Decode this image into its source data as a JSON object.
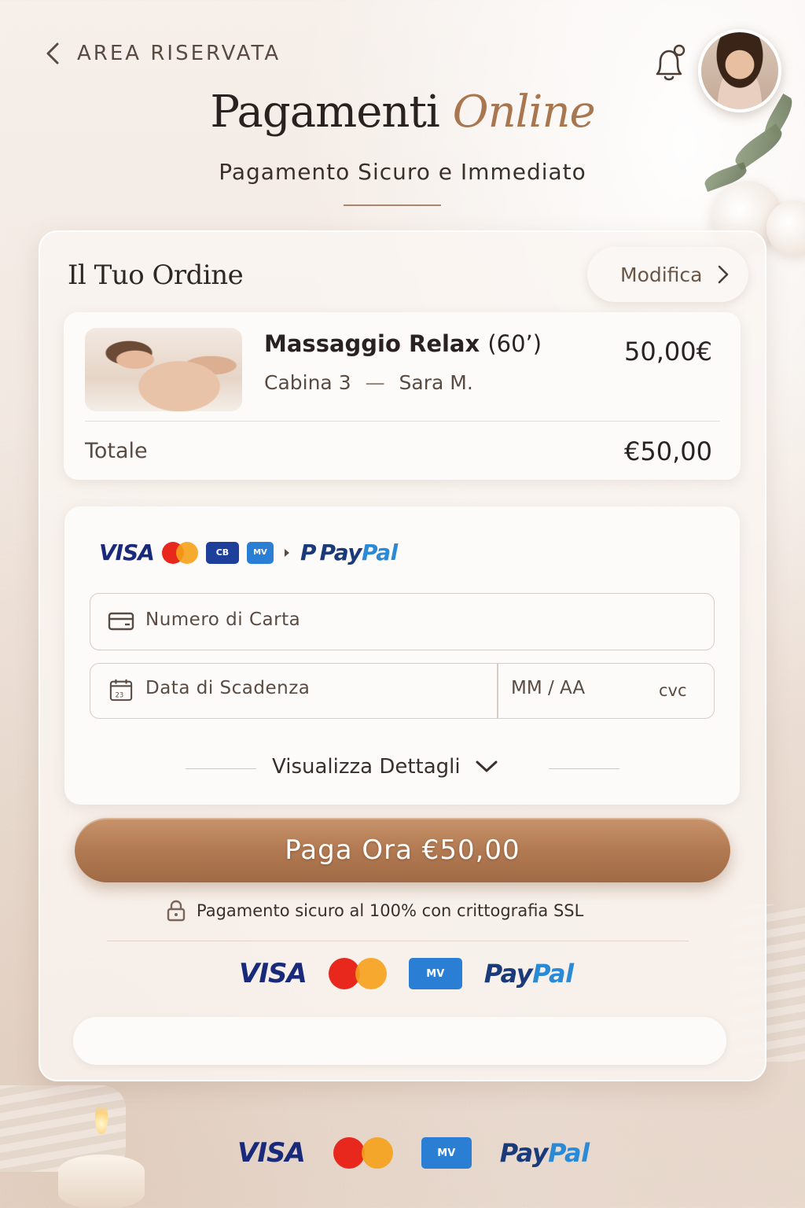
{
  "header": {
    "back_label": "AREA RISERVATA",
    "title_main": "Pagamenti",
    "title_accent": "Online",
    "subtitle": "Pagamento Sicuro e Immediato"
  },
  "order": {
    "title": "Il Tuo Ordine",
    "modify_label": "Modifica",
    "item": {
      "name": "Massaggio Relax",
      "duration": "(60’)",
      "cabin": "Cabina 3",
      "separator": "—",
      "therapist": "Sara M.",
      "price": "50,00€"
    },
    "total_label": "Totale",
    "total_value": "€50,00"
  },
  "payment": {
    "methods": {
      "visa": "VISA",
      "paypal_pay": "Pay",
      "paypal_pal": "Pal",
      "paypal_p": "P",
      "badge_1": "CB",
      "badge_2": "MV"
    },
    "card_number_placeholder": "Numero di Carta",
    "expiry_placeholder": "Data di Scadenza",
    "calendar_day": "23",
    "mm_aa_placeholder": "MM / AA",
    "cvc_placeholder": "cvc",
    "details_label": "Visualizza Dettagli"
  },
  "pay_button_label": "Paga Ora €50,00",
  "secure_note": "Pagamento sicuro al 100% con crittografia SSL",
  "icons": [
    "chevron-left-icon",
    "bell-icon",
    "chevron-right-icon",
    "credit-card-icon",
    "calendar-icon",
    "chevron-down-icon",
    "lock-icon"
  ],
  "colors": {
    "accent": "#a8764f",
    "button": "#b27a52",
    "visa": "#1a2a7a",
    "paypal_dark": "#1b3a7a",
    "paypal_light": "#2a8ad6",
    "mastercard_red": "#e8281c",
    "mastercard_orange": "#f5a11a"
  }
}
